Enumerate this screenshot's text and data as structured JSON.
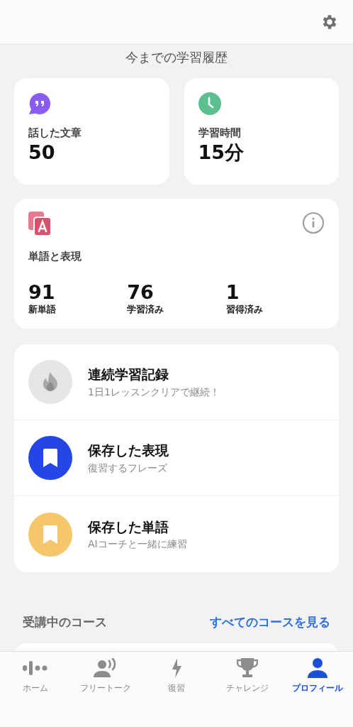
{
  "header": {
    "title": "今までの学習履歴"
  },
  "stats": [
    {
      "label": "話した文章",
      "value": "50"
    },
    {
      "label": "学習時間",
      "value": "15分"
    }
  ],
  "vocabulary": {
    "title": "単語と表現",
    "counts": [
      {
        "value": "91",
        "label": "新単語"
      },
      {
        "value": "76",
        "label": "学習済み"
      },
      {
        "value": "1",
        "label": "習得済み"
      }
    ]
  },
  "shortcuts": [
    {
      "kind": "streak",
      "color": "#e6e6e6",
      "title": "連続学習記録",
      "subtitle": "1日1レッスンクリアで継続！"
    },
    {
      "kind": "saved",
      "color": "#2446e6",
      "title": "保存した表現",
      "subtitle": "復習するフレーズ"
    },
    {
      "kind": "saved",
      "color": "#f5c76a",
      "title": "保存した単語",
      "subtitle": "AIコーチと一緒に練習"
    }
  ],
  "courses": {
    "title": "受講中のコース",
    "link": "すべてのコースを見る"
  },
  "tabs": [
    {
      "label": "ホーム",
      "selected": false
    },
    {
      "label": "フリートーク",
      "selected": false
    },
    {
      "label": "復習",
      "selected": false
    },
    {
      "label": "チャレンジ",
      "selected": false
    },
    {
      "label": "プロフィール",
      "selected": true
    }
  ]
}
